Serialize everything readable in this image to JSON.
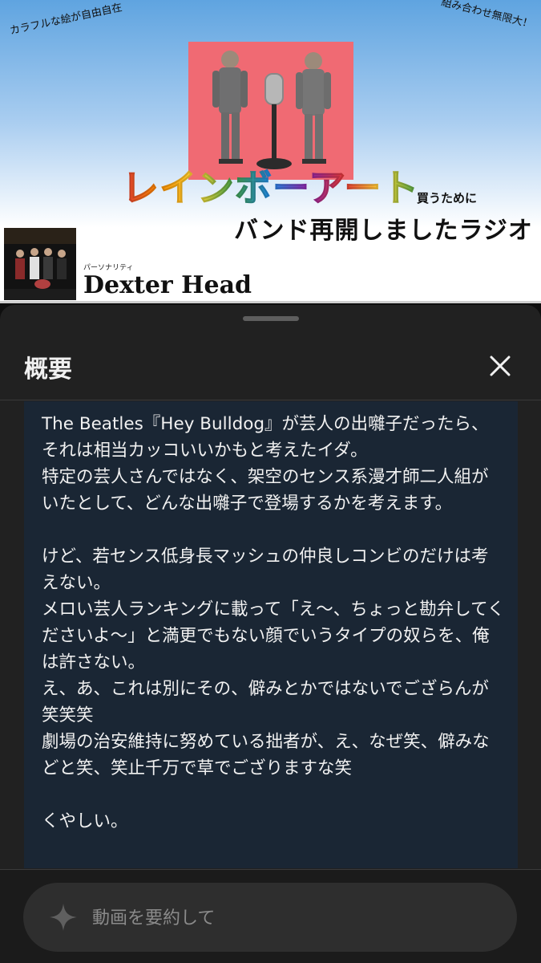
{
  "banner": {
    "tag_left": "カラフルな絵が自由自在",
    "tag_right": "組み合わせ無限大！",
    "title": "レインボーアート",
    "subtitle_small": "買うために",
    "subtitle_big": "バンド再開しましたラジオ",
    "personality_label": "パーソナリティ",
    "host_name": "Dexter Head"
  },
  "sheet": {
    "title": "概要",
    "close_icon": "close-icon",
    "description": "The Beatles『Hey Bulldog』が芸人の出囃子だったら、それは相当カッコいいかもと考えたイダ。\n特定の芸人さんではなく、架空のセンス系漫才師二人組がいたとして、どんな出囃子で登場するかを考えます。\n\nけど、若センス低身長マッシュの仲良しコンビのだけは考えない。\nメロい芸人ランキングに載って「え〜、ちょっと勘弁してくださいよ〜」と満更でもない顔でいうタイプの奴らを、俺は許さない。\nえ、あ、これは別にその、僻みとかではないでござらんが笑笑笑\n劇場の治安維持に努めている拙者が、え、なぜ笑、僻みなどと笑、笑止千万で草でござりますな笑\n\nくやしい。"
  },
  "bottom": {
    "summary_placeholder": "動画を要約して",
    "sparkle_icon": "sparkle-icon"
  },
  "colors": {
    "sheet_bg": "#212121",
    "desc_bg": "#1a2634",
    "cover_bg": "#f06a73"
  }
}
